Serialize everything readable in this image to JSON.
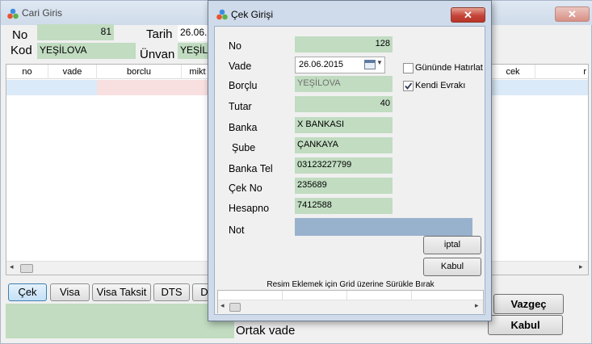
{
  "background_window": {
    "title": "Cari Giris",
    "no_label": "No",
    "no_value": "81",
    "kod_label": "Kod",
    "kod_value": "YEŞİLOVA",
    "tarih_label": "Tarih",
    "tarih_value": "26.06.2",
    "unvan_label": "Ünvan",
    "unvan_value": "YEŞİLO",
    "grid_headers": [
      "no",
      "vade",
      "borclu",
      "mikt",
      "cek",
      "r"
    ],
    "tabs": [
      "Çek",
      "Visa",
      "Visa Taksit",
      "DTS",
      "D"
    ],
    "active_tab": "Çek",
    "vazgec_label": "Vazgeç",
    "kabul_label": "Kabul",
    "ortak_vade_label": "Ortak vade"
  },
  "dialog": {
    "title": "Çek Girişi",
    "close_symbol": "✕",
    "fields": {
      "no": {
        "label": "No",
        "value": "128"
      },
      "vade": {
        "label": "Vade",
        "value": "26.06.2015"
      },
      "borclu": {
        "label": "Borçlu",
        "value": "YEŞİLOVA"
      },
      "tutar": {
        "label": "Tutar",
        "value": "40"
      },
      "banka": {
        "label": "Banka",
        "value": "X BANKASI"
      },
      "sube": {
        "label": "Şube",
        "value": "ÇANKAYA"
      },
      "banka_tel": {
        "label": "Banka Tel",
        "value": "03123227799"
      },
      "cek_no": {
        "label": "Çek No",
        "value": "235689"
      },
      "hesapno": {
        "label": "Hesapno",
        "value": "7412588"
      },
      "not": {
        "label": "Not",
        "value": ""
      }
    },
    "checkboxes": {
      "gununde_hatirlat": {
        "label": "Gününde Hatırlat",
        "checked": false
      },
      "kendi_evraki": {
        "label": "Kendi Evrakı",
        "checked": true
      }
    },
    "iptal_label": "iptal",
    "kabul_label": "Kabul",
    "drag_hint": "Resim Eklemek için Grid üzerine Sürükle Bırak"
  },
  "colors": {
    "field_green": "#c1dcc1",
    "note_blue": "#98b2cd",
    "row_selected": "#dbeaf8",
    "close_red": "#c5453a"
  }
}
